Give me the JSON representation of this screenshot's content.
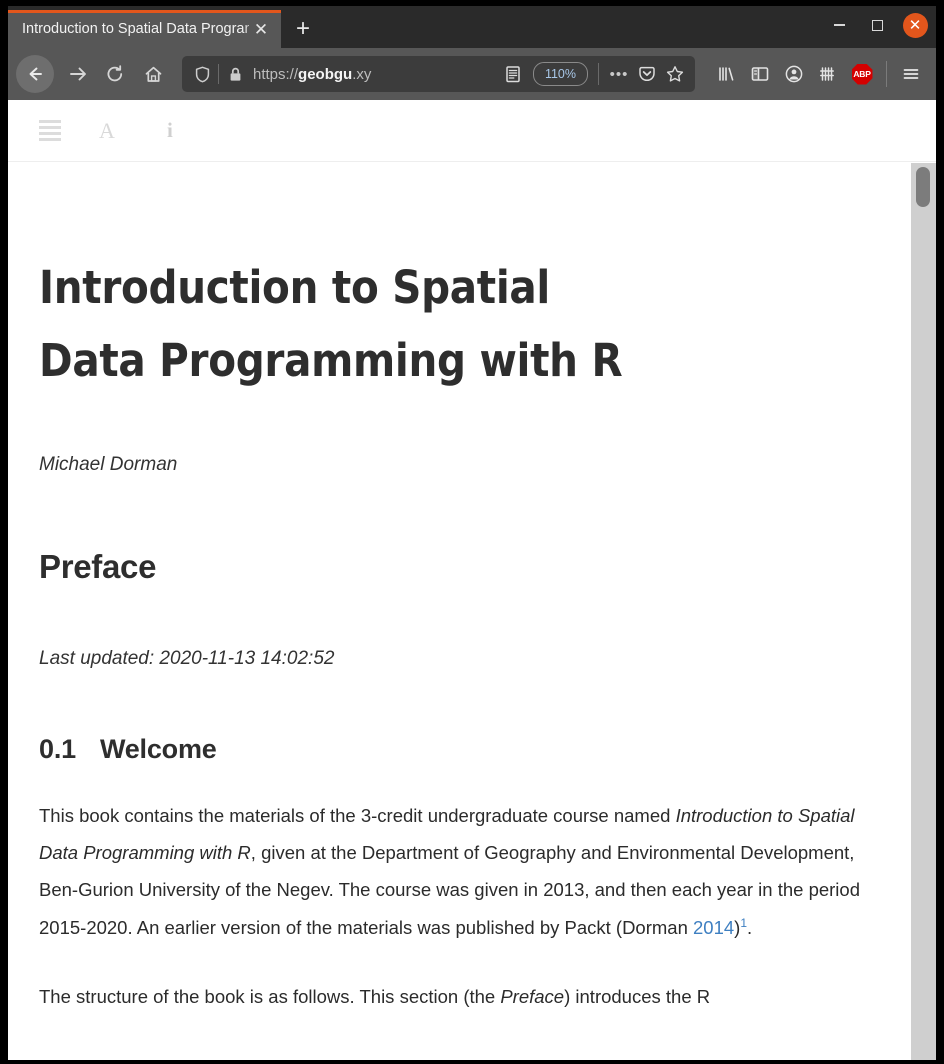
{
  "browser": {
    "tab": {
      "title": "Introduction to Spatial Data Programming with R",
      "close_label": "✕"
    },
    "new_tab_label": "+",
    "window_controls": {
      "minimize": "minimize-icon",
      "maximize": "maximize-icon",
      "close": "✕"
    },
    "nav": {
      "back": "back-arrow-icon",
      "forward": "forward-arrow-icon",
      "reload": "reload-icon",
      "home": "home-icon"
    },
    "urlbar": {
      "shield_icon": "tracking-protection-shield-icon",
      "lock_icon": "padlock-icon",
      "url_scheme": "https://",
      "url_host": "geobgu",
      "url_rest": ".xy",
      "reader_icon": "reader-view-icon",
      "zoom_level": "110%",
      "more_actions": "•••",
      "pocket_icon": "pocket-icon",
      "bookmark_icon": "star-icon"
    },
    "toolbar_icons": [
      {
        "name": "library-icon",
        "label": "Library"
      },
      {
        "name": "sidebar-toggle-icon",
        "label": "Sidebars"
      },
      {
        "name": "account-icon",
        "label": "Account"
      },
      {
        "name": "containers-icon",
        "label": "Containers"
      },
      {
        "name": "adblock-plus-icon",
        "label": "ABP"
      },
      {
        "name": "app-menu-icon",
        "label": "Menu"
      }
    ]
  },
  "book_toolbar": {
    "toc_label": "toc-icon",
    "font_label": "A",
    "info_label": "i"
  },
  "document": {
    "title": "Introduction to Spatial Data Programming with R",
    "author": "Michael Dorman",
    "chapter": "Preface",
    "last_updated": "Last updated: 2020-11-13 14:02:52",
    "section": {
      "number": "0.1",
      "name": "Welcome"
    },
    "paragraph1": {
      "part1": "This book contains the materials of the 3-credit undergraduate course named ",
      "italic1": "Introduction to Spatial Data Programming with R",
      "part2": ", given at the Department of Geography and Environmental Development, Ben-Gurion University of the Negev. The course was given in 2013, and then each year in the period 2015-2020. An earlier version of the materials was published by Packt (Dorman ",
      "link": "2014",
      "part3": ")",
      "footnote": "1",
      "part4": "."
    },
    "paragraph2": {
      "part1": "The structure of the book is as follows. This section (the ",
      "italic1": "Preface",
      "part2": ") introduces the R"
    }
  },
  "colors": {
    "accent_orange": "#e2561c",
    "link_blue": "#3e7fc1",
    "chrome_dark": "#2a2a2a",
    "chrome_mid": "#575757",
    "adblock_red": "#d40000"
  }
}
